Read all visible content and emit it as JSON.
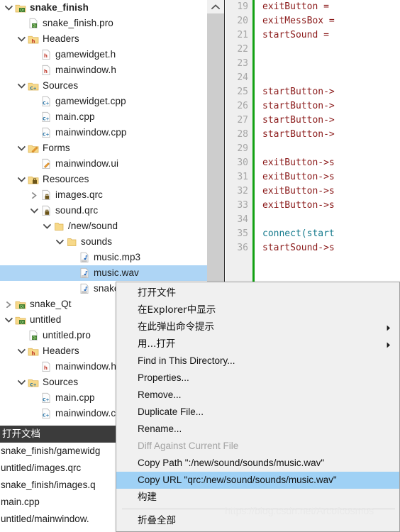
{
  "tree": {
    "rows": [
      {
        "indent": 0,
        "twisty": "chevron-down-icon",
        "icon": "qt-project-folder-icon",
        "label": "snake_finish",
        "bold": true,
        "selected": false
      },
      {
        "indent": 1,
        "twisty": "none",
        "icon": "qt-pro-file-icon",
        "label": "snake_finish.pro",
        "bold": false,
        "selected": false
      },
      {
        "indent": 1,
        "twisty": "chevron-down-icon",
        "icon": "headers-folder-icon",
        "label": "Headers",
        "bold": false,
        "selected": false
      },
      {
        "indent": 2,
        "twisty": "none",
        "icon": "header-file-icon",
        "label": "gamewidget.h",
        "bold": false,
        "selected": false
      },
      {
        "indent": 2,
        "twisty": "none",
        "icon": "header-file-icon",
        "label": "mainwindow.h",
        "bold": false,
        "selected": false
      },
      {
        "indent": 1,
        "twisty": "chevron-down-icon",
        "icon": "sources-folder-icon",
        "label": "Sources",
        "bold": false,
        "selected": false
      },
      {
        "indent": 2,
        "twisty": "none",
        "icon": "cpp-file-icon",
        "label": "gamewidget.cpp",
        "bold": false,
        "selected": false
      },
      {
        "indent": 2,
        "twisty": "none",
        "icon": "cpp-file-icon",
        "label": "main.cpp",
        "bold": false,
        "selected": false
      },
      {
        "indent": 2,
        "twisty": "none",
        "icon": "cpp-file-icon",
        "label": "mainwindow.cpp",
        "bold": false,
        "selected": false
      },
      {
        "indent": 1,
        "twisty": "chevron-down-icon",
        "icon": "forms-folder-icon",
        "label": "Forms",
        "bold": false,
        "selected": false
      },
      {
        "indent": 2,
        "twisty": "none",
        "icon": "ui-file-icon",
        "label": "mainwindow.ui",
        "bold": false,
        "selected": false
      },
      {
        "indent": 1,
        "twisty": "chevron-down-icon",
        "icon": "resources-folder-icon",
        "label": "Resources",
        "bold": false,
        "selected": false
      },
      {
        "indent": 2,
        "twisty": "chevron-right-icon",
        "icon": "qrc-file-icon",
        "label": "images.qrc",
        "bold": false,
        "selected": false
      },
      {
        "indent": 2,
        "twisty": "chevron-down-icon",
        "icon": "qrc-file-icon",
        "label": "sound.qrc",
        "bold": false,
        "selected": false
      },
      {
        "indent": 3,
        "twisty": "chevron-down-icon",
        "icon": "plain-folder-icon",
        "label": "/new/sound",
        "bold": false,
        "selected": false
      },
      {
        "indent": 4,
        "twisty": "chevron-down-icon",
        "icon": "plain-folder-icon",
        "label": "sounds",
        "bold": false,
        "selected": false
      },
      {
        "indent": 5,
        "twisty": "none",
        "icon": "audio-file-icon",
        "label": "music.mp3",
        "bold": false,
        "selected": false
      },
      {
        "indent": 5,
        "twisty": "none",
        "icon": "audio-file-icon",
        "label": "music.wav",
        "bold": false,
        "selected": true
      },
      {
        "indent": 5,
        "twisty": "none",
        "icon": "audio-file-icon",
        "label": "snake.wav",
        "bold": false,
        "selected": false
      },
      {
        "indent": 0,
        "twisty": "chevron-right-icon",
        "icon": "qt-project-folder-icon",
        "label": "snake_Qt",
        "bold": false,
        "selected": false
      },
      {
        "indent": 0,
        "twisty": "chevron-down-icon",
        "icon": "qt-project-folder-icon",
        "label": "untitled",
        "bold": false,
        "selected": false
      },
      {
        "indent": 1,
        "twisty": "none",
        "icon": "qt-pro-file-icon",
        "label": "untitled.pro",
        "bold": false,
        "selected": false
      },
      {
        "indent": 1,
        "twisty": "chevron-down-icon",
        "icon": "headers-folder-icon",
        "label": "Headers",
        "bold": false,
        "selected": false
      },
      {
        "indent": 2,
        "twisty": "none",
        "icon": "header-file-icon",
        "label": "mainwindow.h",
        "bold": false,
        "selected": false
      },
      {
        "indent": 1,
        "twisty": "chevron-down-icon",
        "icon": "sources-folder-icon",
        "label": "Sources",
        "bold": false,
        "selected": false
      },
      {
        "indent": 2,
        "twisty": "none",
        "icon": "cpp-file-icon",
        "label": "main.cpp",
        "bold": false,
        "selected": false
      },
      {
        "indent": 2,
        "twisty": "none",
        "icon": "cpp-file-icon",
        "label": "mainwindow.cpp",
        "bold": false,
        "selected": false
      }
    ]
  },
  "scrollbar": {
    "up_arrow_icon": "chevron-up-icon"
  },
  "editor": {
    "lines": [
      {
        "num": "19",
        "text": "exitButton = ",
        "kw": false
      },
      {
        "num": "20",
        "text": "exitMessBox =",
        "kw": false
      },
      {
        "num": "21",
        "text": "startSound = ",
        "kw": false
      },
      {
        "num": "22",
        "text": "",
        "kw": false
      },
      {
        "num": "23",
        "text": "",
        "kw": false
      },
      {
        "num": "24",
        "text": "",
        "kw": false
      },
      {
        "num": "25",
        "text": "startButton->",
        "kw": false
      },
      {
        "num": "26",
        "text": "startButton->",
        "kw": false
      },
      {
        "num": "27",
        "text": "startButton->",
        "kw": false
      },
      {
        "num": "28",
        "text": "startButton->",
        "kw": false
      },
      {
        "num": "29",
        "text": "",
        "kw": false
      },
      {
        "num": "30",
        "text": "exitButton->s",
        "kw": false
      },
      {
        "num": "31",
        "text": "exitButton->s",
        "kw": false
      },
      {
        "num": "32",
        "text": "exitButton->s",
        "kw": false
      },
      {
        "num": "33",
        "text": "exitButton->s",
        "kw": false
      },
      {
        "num": "34",
        "text": "",
        "kw": false
      },
      {
        "num": "35",
        "text": "connect(start",
        "kw": true
      },
      {
        "num": "36",
        "text": "startSound->s",
        "kw": false
      }
    ]
  },
  "open_documents": {
    "title": "打开文档",
    "items": [
      "snake_finish/gamewidg",
      "untitled/images.qrc",
      "snake_finish/images.q",
      "main.cpp",
      "untitled/mainwindow."
    ]
  },
  "context_menu": {
    "items": [
      {
        "label": "打开文件",
        "cjk": true,
        "disabled": false,
        "highlight": false,
        "submenu": false,
        "separator_after": false
      },
      {
        "label": "在Explorer中显示",
        "cjk": true,
        "disabled": false,
        "highlight": false,
        "submenu": false,
        "separator_after": false
      },
      {
        "label": "在此弹出命令提示",
        "cjk": true,
        "disabled": false,
        "highlight": false,
        "submenu": true,
        "separator_after": false
      },
      {
        "label": "用...打开",
        "cjk": true,
        "disabled": false,
        "highlight": false,
        "submenu": true,
        "separator_after": false
      },
      {
        "label": "Find in This Directory...",
        "cjk": false,
        "disabled": false,
        "highlight": false,
        "submenu": false,
        "separator_after": false
      },
      {
        "label": "Properties...",
        "cjk": false,
        "disabled": false,
        "highlight": false,
        "submenu": false,
        "separator_after": false
      },
      {
        "label": "Remove...",
        "cjk": false,
        "disabled": false,
        "highlight": false,
        "submenu": false,
        "separator_after": false
      },
      {
        "label": "Duplicate File...",
        "cjk": false,
        "disabled": false,
        "highlight": false,
        "submenu": false,
        "separator_after": false
      },
      {
        "label": "Rename...",
        "cjk": false,
        "disabled": false,
        "highlight": false,
        "submenu": false,
        "separator_after": false
      },
      {
        "label": "Diff Against Current File",
        "cjk": false,
        "disabled": true,
        "highlight": false,
        "submenu": false,
        "separator_after": false
      },
      {
        "label": "Copy Path \":/new/sound/sounds/music.wav\"",
        "cjk": false,
        "disabled": false,
        "highlight": false,
        "submenu": false,
        "separator_after": false
      },
      {
        "label": "Copy URL \"qrc:/new/sound/sounds/music.wav\"",
        "cjk": false,
        "disabled": false,
        "highlight": true,
        "submenu": false,
        "separator_after": false
      },
      {
        "label": "构建",
        "cjk": true,
        "disabled": false,
        "highlight": false,
        "submenu": false,
        "separator_after": true
      },
      {
        "label": "折叠全部",
        "cjk": true,
        "disabled": false,
        "highlight": false,
        "submenu": false,
        "separator_after": false
      }
    ]
  },
  "watermark": {
    "text": "https://blog.csdn.net/Arcofcosmos"
  },
  "colors": {
    "selection_blue": "#aed5f5",
    "menu_highlight_blue": "#9fd1f5",
    "menu_bg": "#f0f0f0",
    "code_red": "#8b1a1a",
    "code_teal": "#157a8c",
    "gutter_green": "#12a112",
    "opendocs_header_bg": "#3b3b3b"
  }
}
